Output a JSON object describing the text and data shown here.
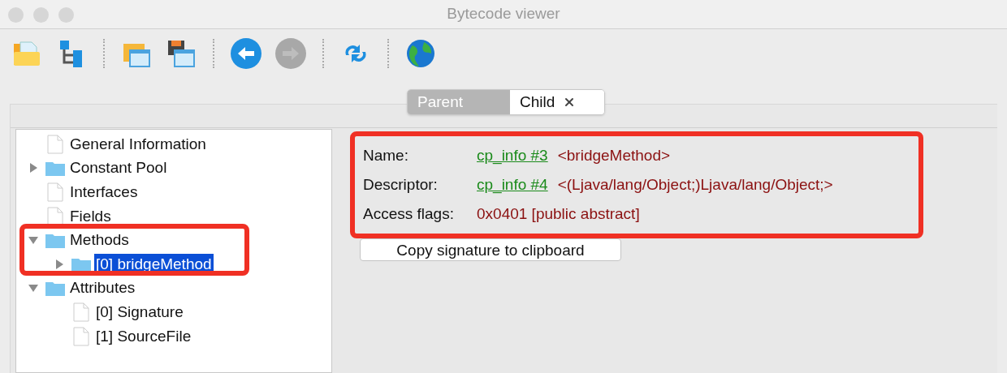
{
  "window": {
    "title": "Bytecode viewer"
  },
  "toolbar": [
    {
      "kind": "open"
    },
    {
      "kind": "tree"
    },
    {
      "kind": "sep"
    },
    {
      "kind": "folder-window"
    },
    {
      "kind": "save-window"
    },
    {
      "kind": "sep"
    },
    {
      "kind": "back",
      "disabled": false
    },
    {
      "kind": "forward",
      "disabled": true
    },
    {
      "kind": "sep"
    },
    {
      "kind": "refresh"
    },
    {
      "kind": "sep"
    },
    {
      "kind": "globe"
    }
  ],
  "tabs": [
    {
      "label": "Parent",
      "selected": false,
      "closable": false
    },
    {
      "label": "Child",
      "selected": true,
      "closable": true
    }
  ],
  "tree": [
    {
      "label": "General Information",
      "kind": "file",
      "selected": false
    },
    {
      "label": "Constant Pool",
      "kind": "folder",
      "expanded": false,
      "selected": false
    },
    {
      "label": "Interfaces",
      "kind": "file",
      "selected": false
    },
    {
      "label": "Fields",
      "kind": "file",
      "selected": false
    },
    {
      "label": "Methods",
      "kind": "folder",
      "expanded": true,
      "selected": false,
      "children": [
        {
          "label": "[0] bridgeMethod",
          "kind": "folder",
          "expanded": false,
          "selected": true
        }
      ]
    },
    {
      "label": "Attributes",
      "kind": "folder",
      "expanded": true,
      "selected": false,
      "children": [
        {
          "label": "[0] Signature",
          "kind": "file",
          "selected": false
        },
        {
          "label": "[1] SourceFile",
          "kind": "file",
          "selected": false
        }
      ]
    }
  ],
  "details": [
    {
      "label": "Name:",
      "link": "cp_info #3",
      "value": "<bridgeMethod>"
    },
    {
      "label": "Descriptor:",
      "link": "cp_info #4",
      "value": "<(Ljava/lang/Object;)Ljava/lang/Object;>"
    },
    {
      "label": "Access flags:",
      "value": "0x0401 [public abstract]"
    }
  ],
  "copy_button": "Copy signature to clipboard"
}
